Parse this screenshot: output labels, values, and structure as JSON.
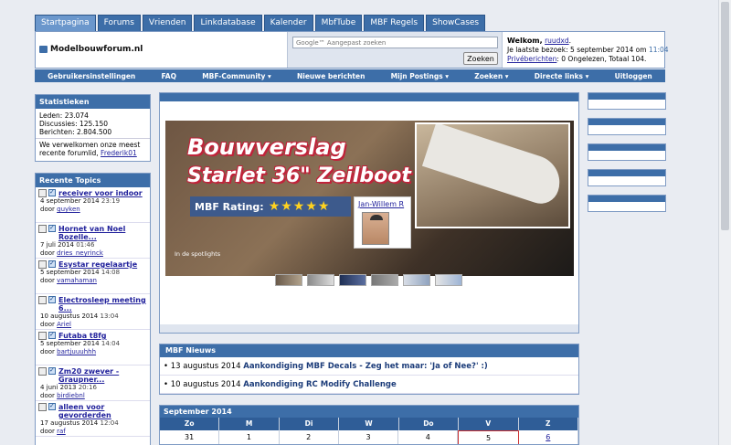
{
  "tabs": [
    "Startpagina",
    "Forums",
    "Vrienden",
    "Linkdatabase",
    "Kalender",
    "MbfTube",
    "MBF Regels",
    "ShowCases"
  ],
  "header": {
    "site_name": "Modelbouwforum.nl",
    "search_placeholder": "Google™ Aangepast zoeken",
    "search_button": "Zoeken",
    "welcome_label": "Welkom,",
    "username": "ruudxd",
    "last_visit": "Je laatste bezoek: 5 september 2014 om",
    "last_visit_time": "11:04",
    "pm_link": "Privéberichten",
    "pm_text": ": 0 Ongelezen, Totaal 104."
  },
  "navbar": [
    "Gebruikersinstellingen",
    "FAQ",
    "MBF-Community ▾",
    "Nieuwe berichten",
    "Mijn Postings ▾",
    "Zoeken ▾",
    "Directe links ▾",
    "Uitloggen"
  ],
  "stats": {
    "title": "Statistieken",
    "members": "Leden: 23.074",
    "discussions": "Discussies: 125.150",
    "posts": "Berichten: 2.804.500",
    "welcome_line1": "We verwelkomen onze meest",
    "welcome_line2": "recente forumlid,",
    "newest_member": "Frederik01"
  },
  "topics": {
    "title": "Recente Topics",
    "items": [
      {
        "title": "receiver voor indoor",
        "date": "4 september 2014",
        "time": "23:19",
        "by": "door",
        "user": "guyken"
      },
      {
        "title": "Hornet van Noel Rozelle...",
        "date": "7 juli 2014",
        "time": "01:46",
        "by": "door",
        "user": "dries_neyrinck"
      },
      {
        "title": "Esystar regelaartje",
        "date": "5 september 2014",
        "time": "14:08",
        "by": "door",
        "user": "vamahaman"
      },
      {
        "title": "Electrosleep meeting 6...",
        "date": "10 augustus 2014",
        "time": "13:04",
        "by": "door",
        "user": "Ariel"
      },
      {
        "title": "Futaba t8fg",
        "date": "5 september 2014",
        "time": "14:04",
        "by": "door",
        "user": "bartjuuuhhh"
      },
      {
        "title": "Zm20 zwever - Graupner...",
        "date": "4 juni 2013",
        "time": "20:16",
        "by": "door",
        "user": "birdiebnl"
      },
      {
        "title": "alleen voor gevorderden",
        "date": "17 augustus 2014",
        "time": "12:04",
        "by": "door",
        "user": "raf"
      }
    ]
  },
  "spotlight": {
    "title_line1": "Bouwverslag",
    "title_line2": "Starlet 36\" Zeilboot",
    "rating_label": "MBF Rating:",
    "rating": 5,
    "stars": "★★★★★",
    "author": "Jan-Willem R",
    "label": "In de spotlights"
  },
  "news": {
    "title": "MBF Nieuws",
    "items": [
      {
        "date": "• 13 augustus 2014",
        "headline": "Aankondiging MBF Decals - Zeg het maar: 'Ja of Nee?' :)"
      },
      {
        "date": "• 10 augustus 2014",
        "headline": "Aankondiging RC Modify Challenge"
      }
    ]
  },
  "calendar": {
    "title": "September 2014",
    "weekdays": [
      "Zo",
      "M",
      "Di",
      "W",
      "Do",
      "V",
      "Z"
    ],
    "days": [
      "31",
      "1",
      "2",
      "3",
      "4",
      "5",
      "6"
    ]
  }
}
